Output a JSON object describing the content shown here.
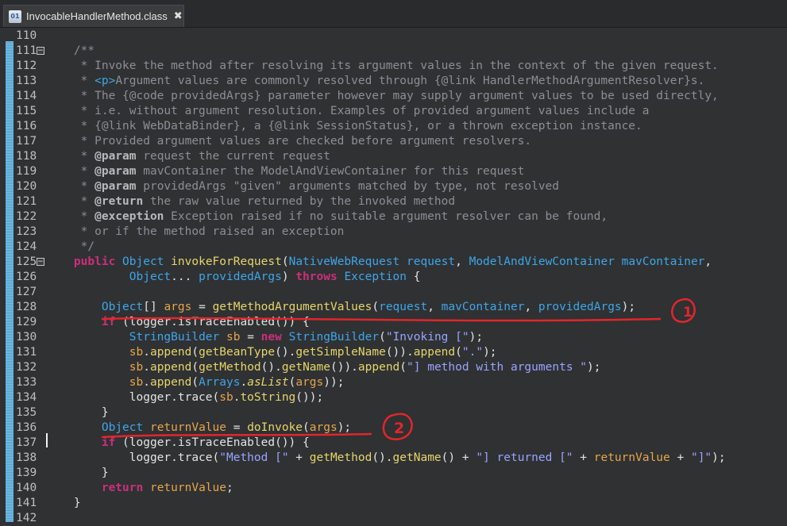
{
  "tab": {
    "title": "InvocableHandlerMethod.class",
    "icon_text": "01",
    "close": "✖"
  },
  "lines": [
    {
      "n": "110",
      "fold": "",
      "parts": []
    },
    {
      "n": "111",
      "fold": "−",
      "parts": [
        {
          "c": "comment",
          "t": "    /**"
        }
      ]
    },
    {
      "n": "112",
      "fold": "",
      "parts": [
        {
          "c": "comment",
          "t": "     * Invoke the method after resolving its argument values in the context of the given request."
        }
      ]
    },
    {
      "n": "113",
      "fold": "",
      "parts": [
        {
          "c": "comment",
          "t": "     * "
        },
        {
          "c": "type",
          "t": "<p>"
        },
        {
          "c": "comment",
          "t": "Argument values are commonly resolved through {@link HandlerMethodArgumentResolver}s."
        }
      ]
    },
    {
      "n": "114",
      "fold": "",
      "parts": [
        {
          "c": "comment",
          "t": "     * The {@code providedArgs} parameter however may supply argument values to be used directly,"
        }
      ]
    },
    {
      "n": "115",
      "fold": "",
      "parts": [
        {
          "c": "comment",
          "t": "     * i.e. without argument resolution. Examples of provided argument values include a"
        }
      ]
    },
    {
      "n": "116",
      "fold": "",
      "parts": [
        {
          "c": "comment",
          "t": "     * {@link WebDataBinder}, a {@link SessionStatus}, or a thrown exception instance."
        }
      ]
    },
    {
      "n": "117",
      "fold": "",
      "parts": [
        {
          "c": "comment",
          "t": "     * Provided argument values are checked before argument resolvers."
        }
      ]
    },
    {
      "n": "118",
      "fold": "",
      "parts": [
        {
          "c": "comment",
          "t": "     * "
        },
        {
          "c": "tag",
          "t": "@param"
        },
        {
          "c": "comment",
          "t": " request the current request"
        }
      ]
    },
    {
      "n": "119",
      "fold": "",
      "parts": [
        {
          "c": "comment",
          "t": "     * "
        },
        {
          "c": "tag",
          "t": "@param"
        },
        {
          "c": "comment",
          "t": " mavContainer the ModelAndViewContainer for this request"
        }
      ]
    },
    {
      "n": "120",
      "fold": "",
      "parts": [
        {
          "c": "comment",
          "t": "     * "
        },
        {
          "c": "tag",
          "t": "@param"
        },
        {
          "c": "comment",
          "t": " providedArgs \"given\" arguments matched by type, not resolved"
        }
      ]
    },
    {
      "n": "121",
      "fold": "",
      "parts": [
        {
          "c": "comment",
          "t": "     * "
        },
        {
          "c": "tag",
          "t": "@return"
        },
        {
          "c": "comment",
          "t": " the raw value returned by the invoked method"
        }
      ]
    },
    {
      "n": "122",
      "fold": "",
      "parts": [
        {
          "c": "comment",
          "t": "     * "
        },
        {
          "c": "tag",
          "t": "@exception"
        },
        {
          "c": "comment",
          "t": " Exception raised if no suitable argument resolver can be found,"
        }
      ]
    },
    {
      "n": "123",
      "fold": "",
      "parts": [
        {
          "c": "comment",
          "t": "     * or if the method raised an exception"
        }
      ]
    },
    {
      "n": "124",
      "fold": "",
      "parts": [
        {
          "c": "comment",
          "t": "     */"
        }
      ]
    },
    {
      "n": "125",
      "fold": "−",
      "parts": [
        {
          "c": "plain",
          "t": "    "
        },
        {
          "c": "kw",
          "t": "public"
        },
        {
          "c": "plain",
          "t": " "
        },
        {
          "c": "type",
          "t": "Object"
        },
        {
          "c": "plain",
          "t": " "
        },
        {
          "c": "method",
          "t": "invokeForRequest"
        },
        {
          "c": "plain",
          "t": "("
        },
        {
          "c": "type",
          "t": "NativeWebRequest"
        },
        {
          "c": "plain",
          "t": " "
        },
        {
          "c": "type",
          "t": "request"
        },
        {
          "c": "plain",
          "t": ", "
        },
        {
          "c": "type",
          "t": "ModelAndViewContainer"
        },
        {
          "c": "plain",
          "t": " "
        },
        {
          "c": "type",
          "t": "mavContainer"
        },
        {
          "c": "plain",
          "t": ","
        }
      ]
    },
    {
      "n": "126",
      "fold": "",
      "parts": [
        {
          "c": "plain",
          "t": "            "
        },
        {
          "c": "type",
          "t": "Object"
        },
        {
          "c": "plain",
          "t": "... "
        },
        {
          "c": "type",
          "t": "providedArgs"
        },
        {
          "c": "plain",
          "t": ") "
        },
        {
          "c": "kw",
          "t": "throws"
        },
        {
          "c": "plain",
          "t": " "
        },
        {
          "c": "type",
          "t": "Exception"
        },
        {
          "c": "plain",
          "t": " {"
        }
      ]
    },
    {
      "n": "127",
      "fold": "",
      "parts": []
    },
    {
      "n": "128",
      "fold": "",
      "parts": [
        {
          "c": "plain",
          "t": "        "
        },
        {
          "c": "type",
          "t": "Object"
        },
        {
          "c": "plain",
          "t": "[] "
        },
        {
          "c": "var",
          "t": "args"
        },
        {
          "c": "plain",
          "t": " = "
        },
        {
          "c": "method",
          "t": "getMethodArgumentValues"
        },
        {
          "c": "plain",
          "t": "("
        },
        {
          "c": "type",
          "t": "request"
        },
        {
          "c": "plain",
          "t": ", "
        },
        {
          "c": "type",
          "t": "mavContainer"
        },
        {
          "c": "plain",
          "t": ", "
        },
        {
          "c": "type",
          "t": "providedArgs"
        },
        {
          "c": "plain",
          "t": ");"
        }
      ]
    },
    {
      "n": "129",
      "fold": "",
      "parts": [
        {
          "c": "plain",
          "t": "        "
        },
        {
          "c": "kw",
          "t": "if"
        },
        {
          "c": "plain",
          "t": " (logger.isTraceEnabled()) {"
        }
      ]
    },
    {
      "n": "130",
      "fold": "",
      "parts": [
        {
          "c": "plain",
          "t": "            "
        },
        {
          "c": "type",
          "t": "StringBuilder"
        },
        {
          "c": "plain",
          "t": " "
        },
        {
          "c": "var",
          "t": "sb"
        },
        {
          "c": "plain",
          "t": " = "
        },
        {
          "c": "kw",
          "t": "new"
        },
        {
          "c": "plain",
          "t": " "
        },
        {
          "c": "type",
          "t": "StringBuilder"
        },
        {
          "c": "plain",
          "t": "("
        },
        {
          "c": "str",
          "t": "\"Invoking [\""
        },
        {
          "c": "plain",
          "t": ");"
        }
      ]
    },
    {
      "n": "131",
      "fold": "",
      "parts": [
        {
          "c": "plain",
          "t": "            "
        },
        {
          "c": "var",
          "t": "sb"
        },
        {
          "c": "plain",
          "t": "."
        },
        {
          "c": "method",
          "t": "append"
        },
        {
          "c": "plain",
          "t": "("
        },
        {
          "c": "method",
          "t": "getBeanType"
        },
        {
          "c": "plain",
          "t": "()."
        },
        {
          "c": "method",
          "t": "getSimpleName"
        },
        {
          "c": "plain",
          "t": "())."
        },
        {
          "c": "method",
          "t": "append"
        },
        {
          "c": "plain",
          "t": "("
        },
        {
          "c": "str",
          "t": "\".\""
        },
        {
          "c": "plain",
          "t": ");"
        }
      ]
    },
    {
      "n": "132",
      "fold": "",
      "parts": [
        {
          "c": "plain",
          "t": "            "
        },
        {
          "c": "var",
          "t": "sb"
        },
        {
          "c": "plain",
          "t": "."
        },
        {
          "c": "method",
          "t": "append"
        },
        {
          "c": "plain",
          "t": "("
        },
        {
          "c": "method",
          "t": "getMethod"
        },
        {
          "c": "plain",
          "t": "()."
        },
        {
          "c": "method",
          "t": "getName"
        },
        {
          "c": "plain",
          "t": "())."
        },
        {
          "c": "method",
          "t": "append"
        },
        {
          "c": "plain",
          "t": "("
        },
        {
          "c": "str",
          "t": "\"] method with arguments \""
        },
        {
          "c": "plain",
          "t": ");"
        }
      ]
    },
    {
      "n": "133",
      "fold": "",
      "parts": [
        {
          "c": "plain",
          "t": "            "
        },
        {
          "c": "var",
          "t": "sb"
        },
        {
          "c": "plain",
          "t": "."
        },
        {
          "c": "method",
          "t": "append"
        },
        {
          "c": "plain",
          "t": "("
        },
        {
          "c": "type",
          "t": "Arrays"
        },
        {
          "c": "plain",
          "t": "."
        },
        {
          "c": "static",
          "t": "asList"
        },
        {
          "c": "plain",
          "t": "("
        },
        {
          "c": "var",
          "t": "args"
        },
        {
          "c": "plain",
          "t": "));"
        }
      ]
    },
    {
      "n": "134",
      "fold": "",
      "parts": [
        {
          "c": "plain",
          "t": "            logger.trace("
        },
        {
          "c": "var",
          "t": "sb"
        },
        {
          "c": "plain",
          "t": "."
        },
        {
          "c": "method",
          "t": "toString"
        },
        {
          "c": "plain",
          "t": "());"
        }
      ]
    },
    {
      "n": "135",
      "fold": "",
      "parts": [
        {
          "c": "plain",
          "t": "        }"
        }
      ]
    },
    {
      "n": "136",
      "fold": "",
      "parts": [
        {
          "c": "plain",
          "t": "        "
        },
        {
          "c": "type",
          "t": "Object"
        },
        {
          "c": "plain",
          "t": " "
        },
        {
          "c": "var",
          "t": "returnValue"
        },
        {
          "c": "plain",
          "t": " = "
        },
        {
          "c": "method",
          "t": "doInvoke"
        },
        {
          "c": "plain",
          "t": "("
        },
        {
          "c": "var",
          "t": "args"
        },
        {
          "c": "plain",
          "t": ");"
        }
      ]
    },
    {
      "n": "137",
      "fold": "",
      "parts": [
        {
          "c": "plain",
          "t": "        "
        },
        {
          "c": "kw",
          "t": "if"
        },
        {
          "c": "plain",
          "t": " (logger.isTraceEnabled()) {"
        }
      ]
    },
    {
      "n": "138",
      "fold": "",
      "parts": [
        {
          "c": "plain",
          "t": "            logger.trace("
        },
        {
          "c": "str",
          "t": "\"Method [\""
        },
        {
          "c": "plain",
          "t": " + "
        },
        {
          "c": "method",
          "t": "getMethod"
        },
        {
          "c": "plain",
          "t": "()."
        },
        {
          "c": "method",
          "t": "getName"
        },
        {
          "c": "plain",
          "t": "() + "
        },
        {
          "c": "str",
          "t": "\"] returned [\""
        },
        {
          "c": "plain",
          "t": " + "
        },
        {
          "c": "var",
          "t": "returnValue"
        },
        {
          "c": "plain",
          "t": " + "
        },
        {
          "c": "str",
          "t": "\"]\""
        },
        {
          "c": "plain",
          "t": ");"
        }
      ]
    },
    {
      "n": "139",
      "fold": "",
      "parts": [
        {
          "c": "plain",
          "t": "        }"
        }
      ]
    },
    {
      "n": "140",
      "fold": "",
      "parts": [
        {
          "c": "plain",
          "t": "        "
        },
        {
          "c": "kw",
          "t": "return"
        },
        {
          "c": "plain",
          "t": " "
        },
        {
          "c": "var",
          "t": "returnValue"
        },
        {
          "c": "plain",
          "t": ";"
        }
      ]
    },
    {
      "n": "141",
      "fold": "",
      "parts": [
        {
          "c": "plain",
          "t": "    }"
        }
      ]
    },
    {
      "n": "142",
      "fold": "",
      "parts": []
    }
  ],
  "annotations": {
    "mark1": "1",
    "mark2": "2",
    "color": "#e2262b"
  },
  "colors": {
    "background": "#2f3133",
    "keyword": "#cc2f7a",
    "type": "#3fa6e8",
    "method": "#e6d56b",
    "variable": "#e4a64a",
    "string": "#9aa4ff",
    "comment": "#8b8f94"
  }
}
